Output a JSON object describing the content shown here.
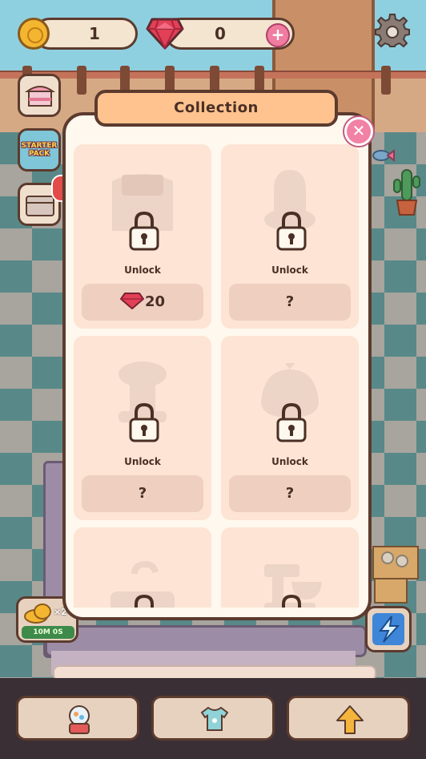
{
  "hud": {
    "coins": "1",
    "gems": "0"
  },
  "side": {
    "starter_pack_line1": "STARTER",
    "starter_pack_line2": "PACK",
    "boost_multiplier": "×2",
    "boost_timer": "10M 0S"
  },
  "modal": {
    "title": "Collection",
    "cards": [
      {
        "label": "Unlock",
        "price": "20",
        "price_type": "gem"
      },
      {
        "label": "Unlock",
        "price": "?",
        "price_type": "unknown"
      },
      {
        "label": "Unlock",
        "price": "?",
        "price_type": "unknown"
      },
      {
        "label": "Unlock",
        "price": "?",
        "price_type": "unknown"
      },
      {
        "label": "",
        "price": "",
        "price_type": "hidden"
      },
      {
        "label": "",
        "price": "",
        "price_type": "hidden"
      }
    ]
  },
  "colors": {
    "modal_bg": "#fff8ee",
    "title_bg": "#ffc38f",
    "card_bg": "#fde4d4",
    "price_bg": "#efcfc0",
    "outline": "#5c3b2e",
    "close_pink": "#f281a6",
    "gem_red": "#e24057"
  },
  "icons": {
    "coin": "cat-coin-icon",
    "gem": "ruby-gem-icon",
    "settings": "gear-icon",
    "lock": "padlock-icon",
    "close": "close-x-icon"
  }
}
